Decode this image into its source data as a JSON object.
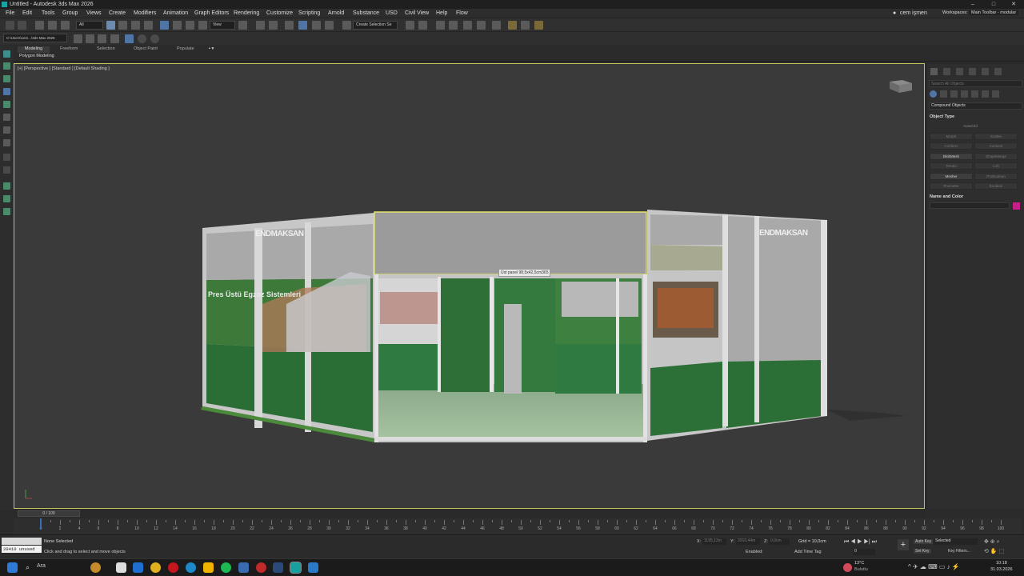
{
  "window": {
    "title": "Untitled - Autodesk 3ds Max 2026",
    "min": "–",
    "max": "□",
    "close": "✕"
  },
  "menu": [
    "File",
    "Edit",
    "Tools",
    "Group",
    "Views",
    "Create",
    "Modifiers",
    "Animation",
    "Graph Editors",
    "Rendering",
    "Customize",
    "Scripting",
    "Arnold",
    "Substance",
    "USD",
    "Civil View",
    "Help",
    "Flow"
  ],
  "user": {
    "name": "cem işmen",
    "workspaces_label": "Workspaces:",
    "workspace": "Main Toolbar - modular"
  },
  "toolbar": {
    "selection_filter": "All",
    "ref_coord": "View",
    "named_selection": "Create Selection Se"
  },
  "project_path": "C:\\Users\\cem...\\3ds Max 2026",
  "ribbon": {
    "tabs": [
      "Modeling",
      "Freeform",
      "Selection",
      "Object Paint",
      "Populate"
    ],
    "active": "Modeling",
    "sub": "Polygon Modeling"
  },
  "viewport": {
    "label": "[+] [Perspective ] [Standard ] [Default Shading ]",
    "tooltip": "Üst panel 98,5x42,5cm365",
    "banner_text_left": "Pres Üstü Egzoz Sistemleri",
    "brand_left": "ENDMAKSAN",
    "brand_right": "ENDMAKSAN"
  },
  "command_panel": {
    "search_placeholder": "Search All Objects",
    "category": "Compound Objects",
    "rollout_object_type": "Object Type",
    "autogrid": "AutoGrid",
    "buttons": [
      {
        "label": "Morph",
        "enabled": false
      },
      {
        "label": "Scatter",
        "enabled": false
      },
      {
        "label": "Conform",
        "enabled": false
      },
      {
        "label": "Connect",
        "enabled": false
      },
      {
        "label": "BlobMesh",
        "enabled": true
      },
      {
        "label": "ShapeMerge",
        "enabled": false
      },
      {
        "label": "Terrain",
        "enabled": false
      },
      {
        "label": "Loft",
        "enabled": false
      },
      {
        "label": "Mesher",
        "enabled": true
      },
      {
        "label": "ProBoolean",
        "enabled": false
      },
      {
        "label": "ProCutter",
        "enabled": false
      },
      {
        "label": "Boolean",
        "enabled": false
      }
    ],
    "rollout_name_color": "Name and Color",
    "color": "#c71f8a"
  },
  "timeline": {
    "slider_label": "0 / 100",
    "ticks": [
      0,
      2,
      4,
      6,
      8,
      10,
      12,
      14,
      16,
      18,
      20,
      22,
      24,
      26,
      28,
      30,
      32,
      34,
      36,
      38,
      40,
      42,
      44,
      46,
      48,
      50,
      52,
      54,
      56,
      58,
      60,
      62,
      64,
      66,
      68,
      70,
      72,
      74,
      76,
      78,
      80,
      82,
      84,
      86,
      88,
      90,
      92,
      94,
      96,
      98,
      100
    ]
  },
  "status": {
    "maxscript": "20410 unused",
    "selection": "None Selected",
    "prompt": "Click and drag to select and move objects",
    "x_label": "X:",
    "x": "1195,13m",
    "y_label": "Y:",
    "y": "2010,44m",
    "z_label": "Z:",
    "z": "0,0cm",
    "grid": "Grid = 10,0cm",
    "enabled": "Enabled:",
    "add_time_tag": "Add Time Tag",
    "auto_key": "Auto Key",
    "set_key": "Set Key",
    "key_mode": "Selected",
    "key_filters": "Key Filters...",
    "frame": "0"
  },
  "taskbar": {
    "search": "Ara",
    "weather_temp": "13°C",
    "weather_desc": "Bulutlu",
    "time": "10:18",
    "date": "31.03.2026"
  }
}
